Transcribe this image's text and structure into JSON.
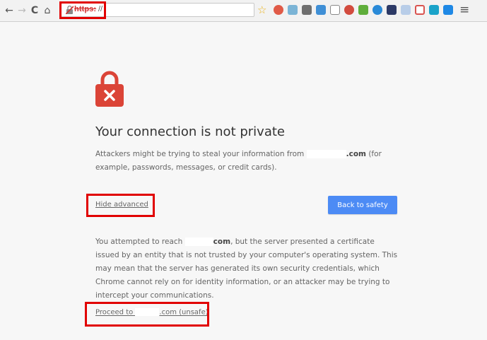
{
  "browser": {
    "nav": {
      "back_glyph": "←",
      "forward_glyph": "→",
      "reload_glyph": "C",
      "home_glyph": "⌂"
    },
    "omnibox": {
      "scheme_text": "https:",
      "rest_text": "//",
      "security_state": "broken-https"
    },
    "extensions": [
      {
        "name": "bookmark-star-icon"
      },
      {
        "name": "extension-1-icon"
      },
      {
        "name": "extension-2-icon"
      },
      {
        "name": "extension-3-icon"
      },
      {
        "name": "extension-4-icon"
      },
      {
        "name": "extension-5-icon"
      },
      {
        "name": "extension-6-icon"
      },
      {
        "name": "extension-7-icon"
      },
      {
        "name": "extension-8-icon"
      },
      {
        "name": "extension-9-icon"
      },
      {
        "name": "extension-10-icon"
      },
      {
        "name": "extension-11-icon"
      },
      {
        "name": "extension-12-icon"
      },
      {
        "name": "extension-13-icon"
      }
    ],
    "menu_glyph": "≡"
  },
  "interstitial": {
    "heading": "Your connection is not private",
    "intro_before": "Attackers might be trying to steal your information from ",
    "intro_domain_suffix": ".com",
    "intro_after": " (for example, passwords, messages, or credit cards).",
    "hide_advanced_label": "Hide advanced",
    "back_to_safety_label": "Back to safety",
    "detail_before": "You attempted to reach ",
    "detail_domain_suffix": "com",
    "detail_after": ", but the server presented a certificate issued by an entity that is not trusted by your computer's operating system. This may mean that the server has generated its own security credentials, which Chrome cannot rely on for identity information, or an attacker may be trying to intercept your communications.",
    "proceed_prefix": "Proceed to ",
    "proceed_suffix": ".com (unsafe)"
  },
  "colors": {
    "annotation_red": "#e10000",
    "lock_red": "#db4437",
    "button_blue": "#4c8bf5"
  }
}
